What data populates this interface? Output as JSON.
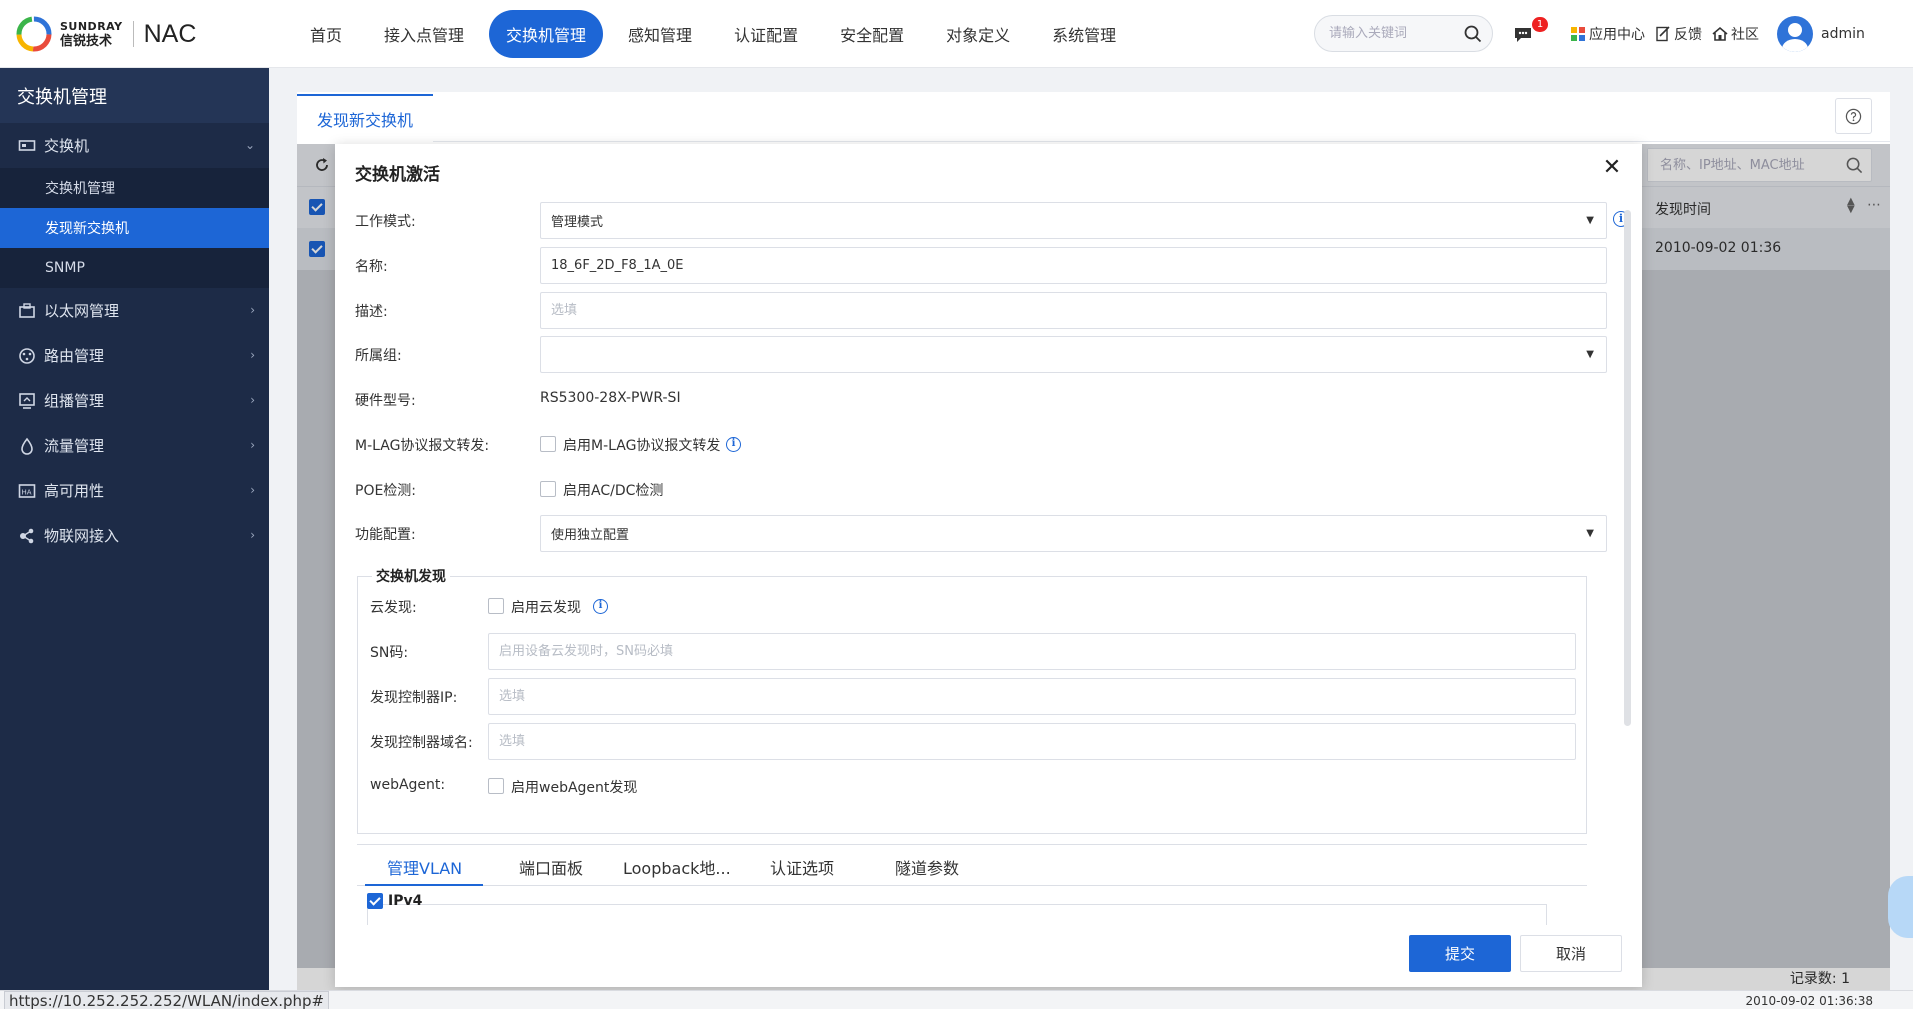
{
  "header": {
    "logo_en": "SUNDRAY",
    "logo_cn": "信锐技术",
    "product": "NAC",
    "nav": [
      "首页",
      "接入点管理",
      "交换机管理",
      "感知管理",
      "认证配置",
      "安全配置",
      "对象定义",
      "系统管理"
    ],
    "active_nav": "交换机管理",
    "search_placeholder": "请输入关键词",
    "message_count": "1",
    "app_center": "应用中心",
    "feedback": "反馈",
    "community": "社区",
    "user": "admin"
  },
  "sidebar": {
    "title": "交换机管理",
    "group": "交换机",
    "sub_items": [
      "交换机管理",
      "发现新交换机",
      "SNMP"
    ],
    "active_sub": "发现新交换机",
    "items": [
      "以太网管理",
      "路由管理",
      "组播管理",
      "流量管理",
      "高可用性",
      "物联网接入"
    ]
  },
  "page": {
    "tab": "发现新交换机",
    "search_placeholder": "名称、IP地址、MAC地址",
    "col_time": "发现时间",
    "row_time": "2010-09-02 01:36",
    "records": "记录数: 1"
  },
  "dialog": {
    "title": "交换机激活",
    "fields": {
      "work_mode_label": "工作模式:",
      "work_mode_value": "管理模式",
      "name_label": "名称:",
      "name_value": "18_6F_2D_F8_1A_0E",
      "desc_label": "描述:",
      "desc_placeholder": "选填",
      "group_label": "所属组:",
      "group_value": "",
      "hw_label": "硬件型号:",
      "hw_value": "RS5300-28X-PWR-SI",
      "mlag_label": "M-LAG协议报文转发:",
      "mlag_check": "启用M-LAG协议报文转发",
      "poe_label": "POE检测:",
      "poe_check": "启用AC/DC检测",
      "func_label": "功能配置:",
      "func_value": "使用独立配置"
    },
    "discovery": {
      "title": "交换机发现",
      "cloud_label": "云发现:",
      "cloud_check": "启用云发现",
      "sn_label": "SN码:",
      "sn_placeholder": "启用设备云发现时，SN码必填",
      "ctrl_ip_label": "发现控制器IP:",
      "ctrl_ip_placeholder": "选填",
      "ctrl_domain_label": "发现控制器域名:",
      "ctrl_domain_placeholder": "选填",
      "webagent_label": "webAgent:",
      "webagent_check": "启用webAgent发现"
    },
    "subtabs": [
      "管理VLAN",
      "端口面板",
      "Loopback地...",
      "认证选项",
      "隧道参数"
    ],
    "active_subtab": "管理VLAN",
    "ipv4": "IPv4",
    "submit": "提交",
    "cancel": "取消"
  },
  "status": {
    "url": "https://10.252.252.252/WLAN/index.php#",
    "time": "2010-09-02 01:36:38"
  }
}
